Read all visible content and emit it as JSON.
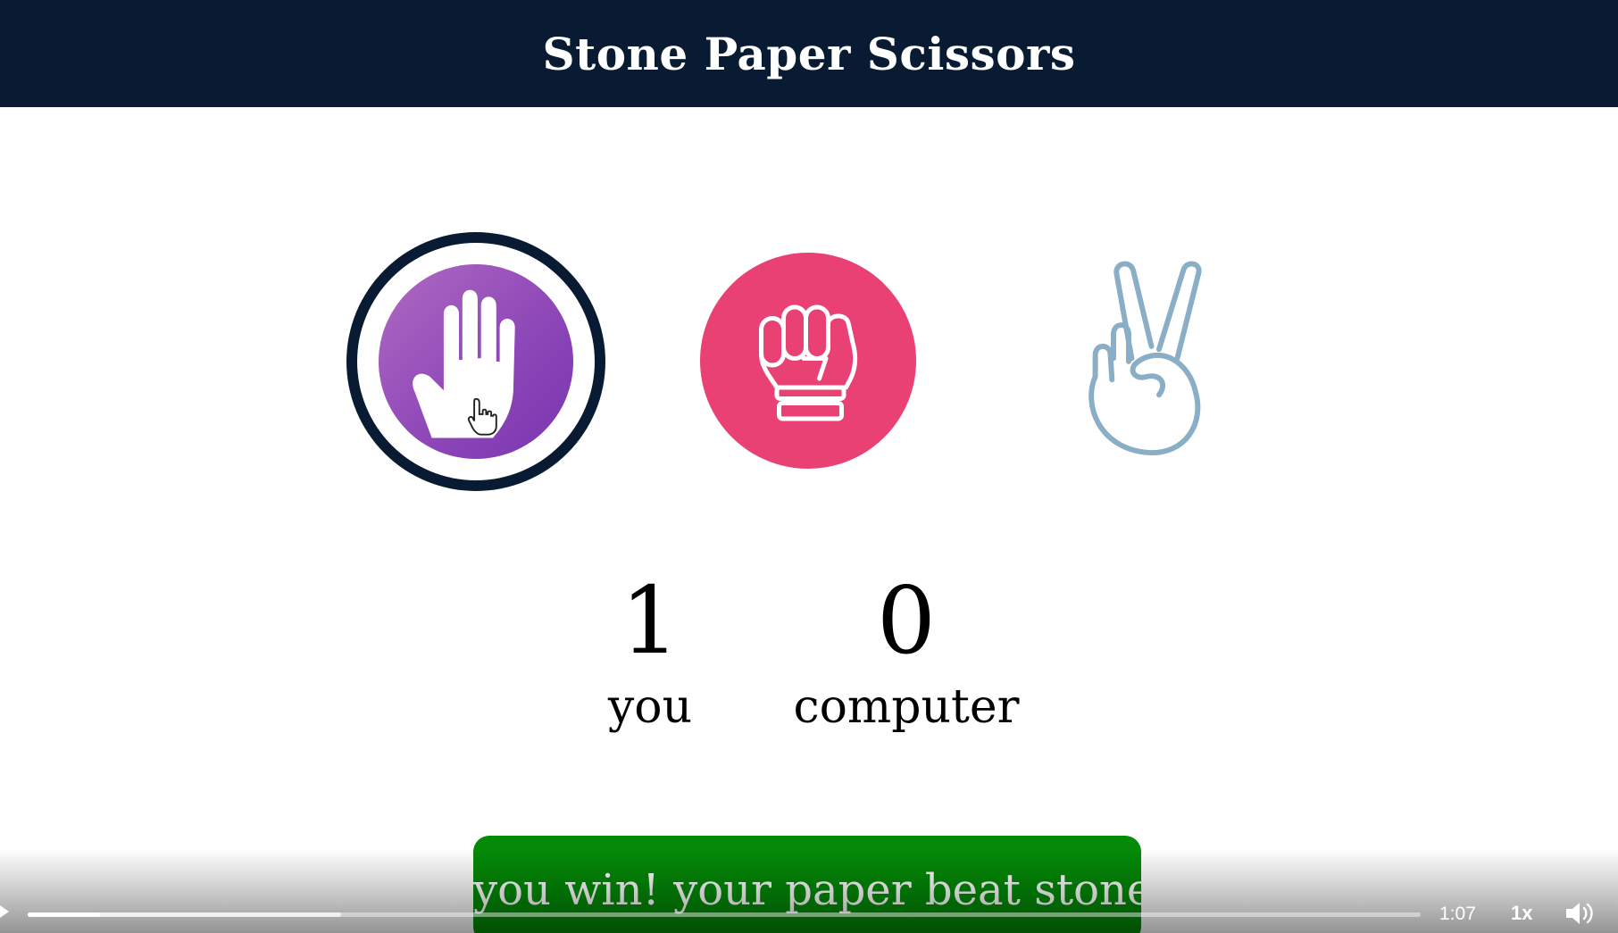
{
  "header": {
    "title": "Stone Paper Scissors"
  },
  "choices": [
    {
      "id": "paper",
      "icon": "open-hand-icon",
      "selected": true
    },
    {
      "id": "stone",
      "icon": "fist-icon",
      "selected": false
    },
    {
      "id": "scissors",
      "icon": "victory-hand-icon",
      "selected": false
    }
  ],
  "score": {
    "user_score": "1",
    "user_label": "you",
    "computer_score": "0",
    "computer_label": "computer"
  },
  "message": {
    "text": "you win! your paper beat stone",
    "color": "#038a07"
  },
  "colors": {
    "header_bg": "#081b33",
    "paper_circle": "#8f48b8",
    "stone_circle": "#ea4174",
    "scissors_stroke": "#8aaec6"
  },
  "video_player": {
    "time": "1:07",
    "speed": "1x",
    "progress_played": 0.052,
    "progress_buffered": 0.225,
    "play_icon": "play-icon",
    "volume_icon": "volume-icon"
  }
}
